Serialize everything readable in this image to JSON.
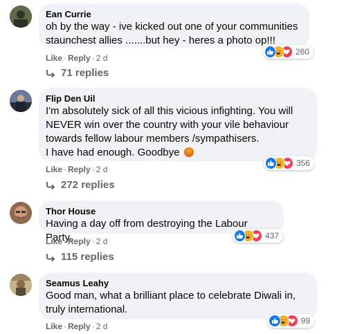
{
  "comments": [
    {
      "author": "Ean Currie",
      "text": "oh by the way - ive kicked out one of your communities\nstaunchest allies .......but hey - heres a photo op!!!",
      "actions": {
        "like": "Like",
        "reply": "Reply",
        "time": "2 d"
      },
      "reaction_count": "260",
      "replies": "71 replies",
      "avatar_color": "#4a5a3c"
    },
    {
      "author": "Flip Den Uil",
      "text": "I'm absolutely sick of all this vicious infighting. You will\nNEVER win over the country with your vile behaviour\ntowards fellow labour members /sympathisers.\nI have had enough. Goodbye",
      "actions": {
        "like": "Like",
        "reply": "Reply",
        "time": "2 d"
      },
      "reaction_count": "356",
      "replies": "272 replies",
      "avatar_color": "#3d4a63"
    },
    {
      "author": "Thor House",
      "text": "Having a day off from destroying the Labour Party.",
      "actions": {
        "like": "Like",
        "reply": "Reply",
        "time": "2 d"
      },
      "reaction_count": "437",
      "replies": "115 replies",
      "avatar_color": "#b07c5c"
    },
    {
      "author": "Seamus Leahy",
      "text": "Good man, what a brilliant place to celebrate Diwali in,\ntruly international.",
      "actions": {
        "like": "Like",
        "reply": "Reply",
        "time": "2 d"
      },
      "reaction_count": "99",
      "avatar_color": "#8a7a5a"
    }
  ],
  "reaction_icons": [
    "like-icon",
    "haha-icon",
    "love-icon"
  ],
  "colors": {
    "like": "#1877f2",
    "love": "#f33e58",
    "haha": "#f7b125",
    "bubble": "#f0f2f5",
    "muted": "#65676b"
  }
}
